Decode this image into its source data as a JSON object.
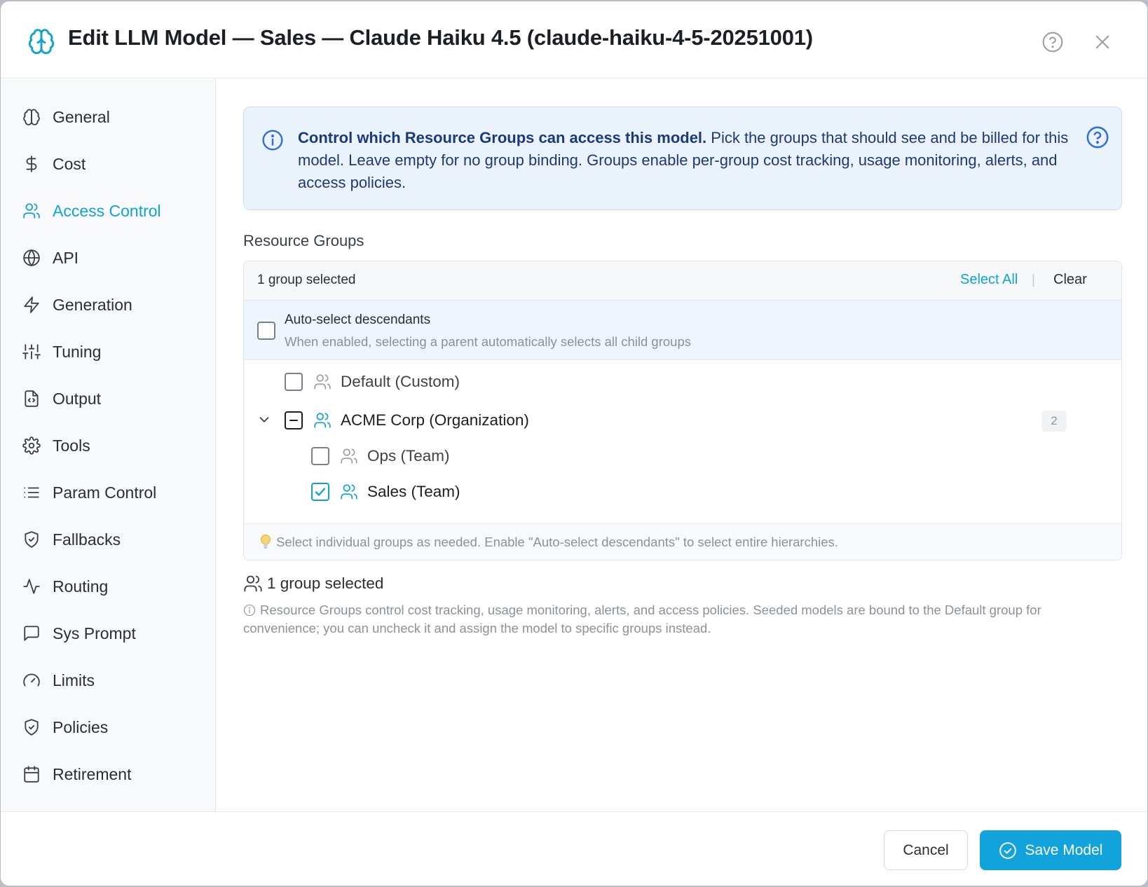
{
  "header": {
    "title": "Edit LLM Model — Sales — Claude Haiku 4.5 (claude-haiku-4-5-20251001)",
    "logo_icon": "brain-icon",
    "help_icon": "help-circle-icon",
    "close_icon": "close-icon"
  },
  "sidebar": {
    "items": [
      {
        "label": "General",
        "icon": "brain-icon"
      },
      {
        "label": "Cost",
        "icon": "dollar-icon"
      },
      {
        "label": "Access Control",
        "icon": "users-icon",
        "active": true
      },
      {
        "label": "API",
        "icon": "globe-icon"
      },
      {
        "label": "Generation",
        "icon": "lightning-icon"
      },
      {
        "label": "Tuning",
        "icon": "sliders-icon"
      },
      {
        "label": "Output",
        "icon": "file-code-icon"
      },
      {
        "label": "Tools",
        "icon": "gear-icon"
      },
      {
        "label": "Param Control",
        "icon": "list-icon"
      },
      {
        "label": "Fallbacks",
        "icon": "shield-check-icon"
      },
      {
        "label": "Routing",
        "icon": "activity-icon"
      },
      {
        "label": "Sys Prompt",
        "icon": "message-square-icon"
      },
      {
        "label": "Limits",
        "icon": "gauge-icon"
      },
      {
        "label": "Policies",
        "icon": "shield-check-icon"
      },
      {
        "label": "Retirement",
        "icon": "calendar-icon"
      }
    ]
  },
  "info": {
    "bold": "Control which Resource Groups can access this model.",
    "text": " Pick the groups that should see and be billed for this model. Leave empty for no group binding. Groups enable per-group cost tracking, usage monitoring, alerts, and access policies."
  },
  "resource_groups": {
    "label": "Resource Groups",
    "count_text": "1 group selected",
    "select_all": "Select All",
    "separator": "|",
    "clear": "Clear",
    "auto_select": {
      "title": "Auto-select descendants",
      "description": "When enabled, selecting a parent automatically selects all child groups",
      "checked": false
    },
    "tree": [
      {
        "label": "Default (Custom)",
        "state": "unchecked"
      },
      {
        "label": "ACME Corp (Organization)",
        "state": "indeterminate",
        "expanded": true,
        "child_count": "2"
      },
      {
        "label": "Ops (Team)",
        "state": "unchecked"
      },
      {
        "label": "Sales (Team)",
        "state": "checked"
      }
    ],
    "tip": "Select individual groups as needed. Enable \"Auto-select descendants\" to select entire hierarchies."
  },
  "summary": {
    "text": "1 group selected",
    "note": "Resource Groups control cost tracking, usage monitoring, alerts, and access policies. Seeded models are bound to the Default group for convenience; you can uncheck it and assign the model to specific groups instead."
  },
  "footer": {
    "cancel": "Cancel",
    "save": "Save Model"
  },
  "colors": {
    "accent": "#12a3cf",
    "primary_button": "#12a3dc",
    "info_bg": "#eaf3fc",
    "info_text": "#1f3a72"
  }
}
